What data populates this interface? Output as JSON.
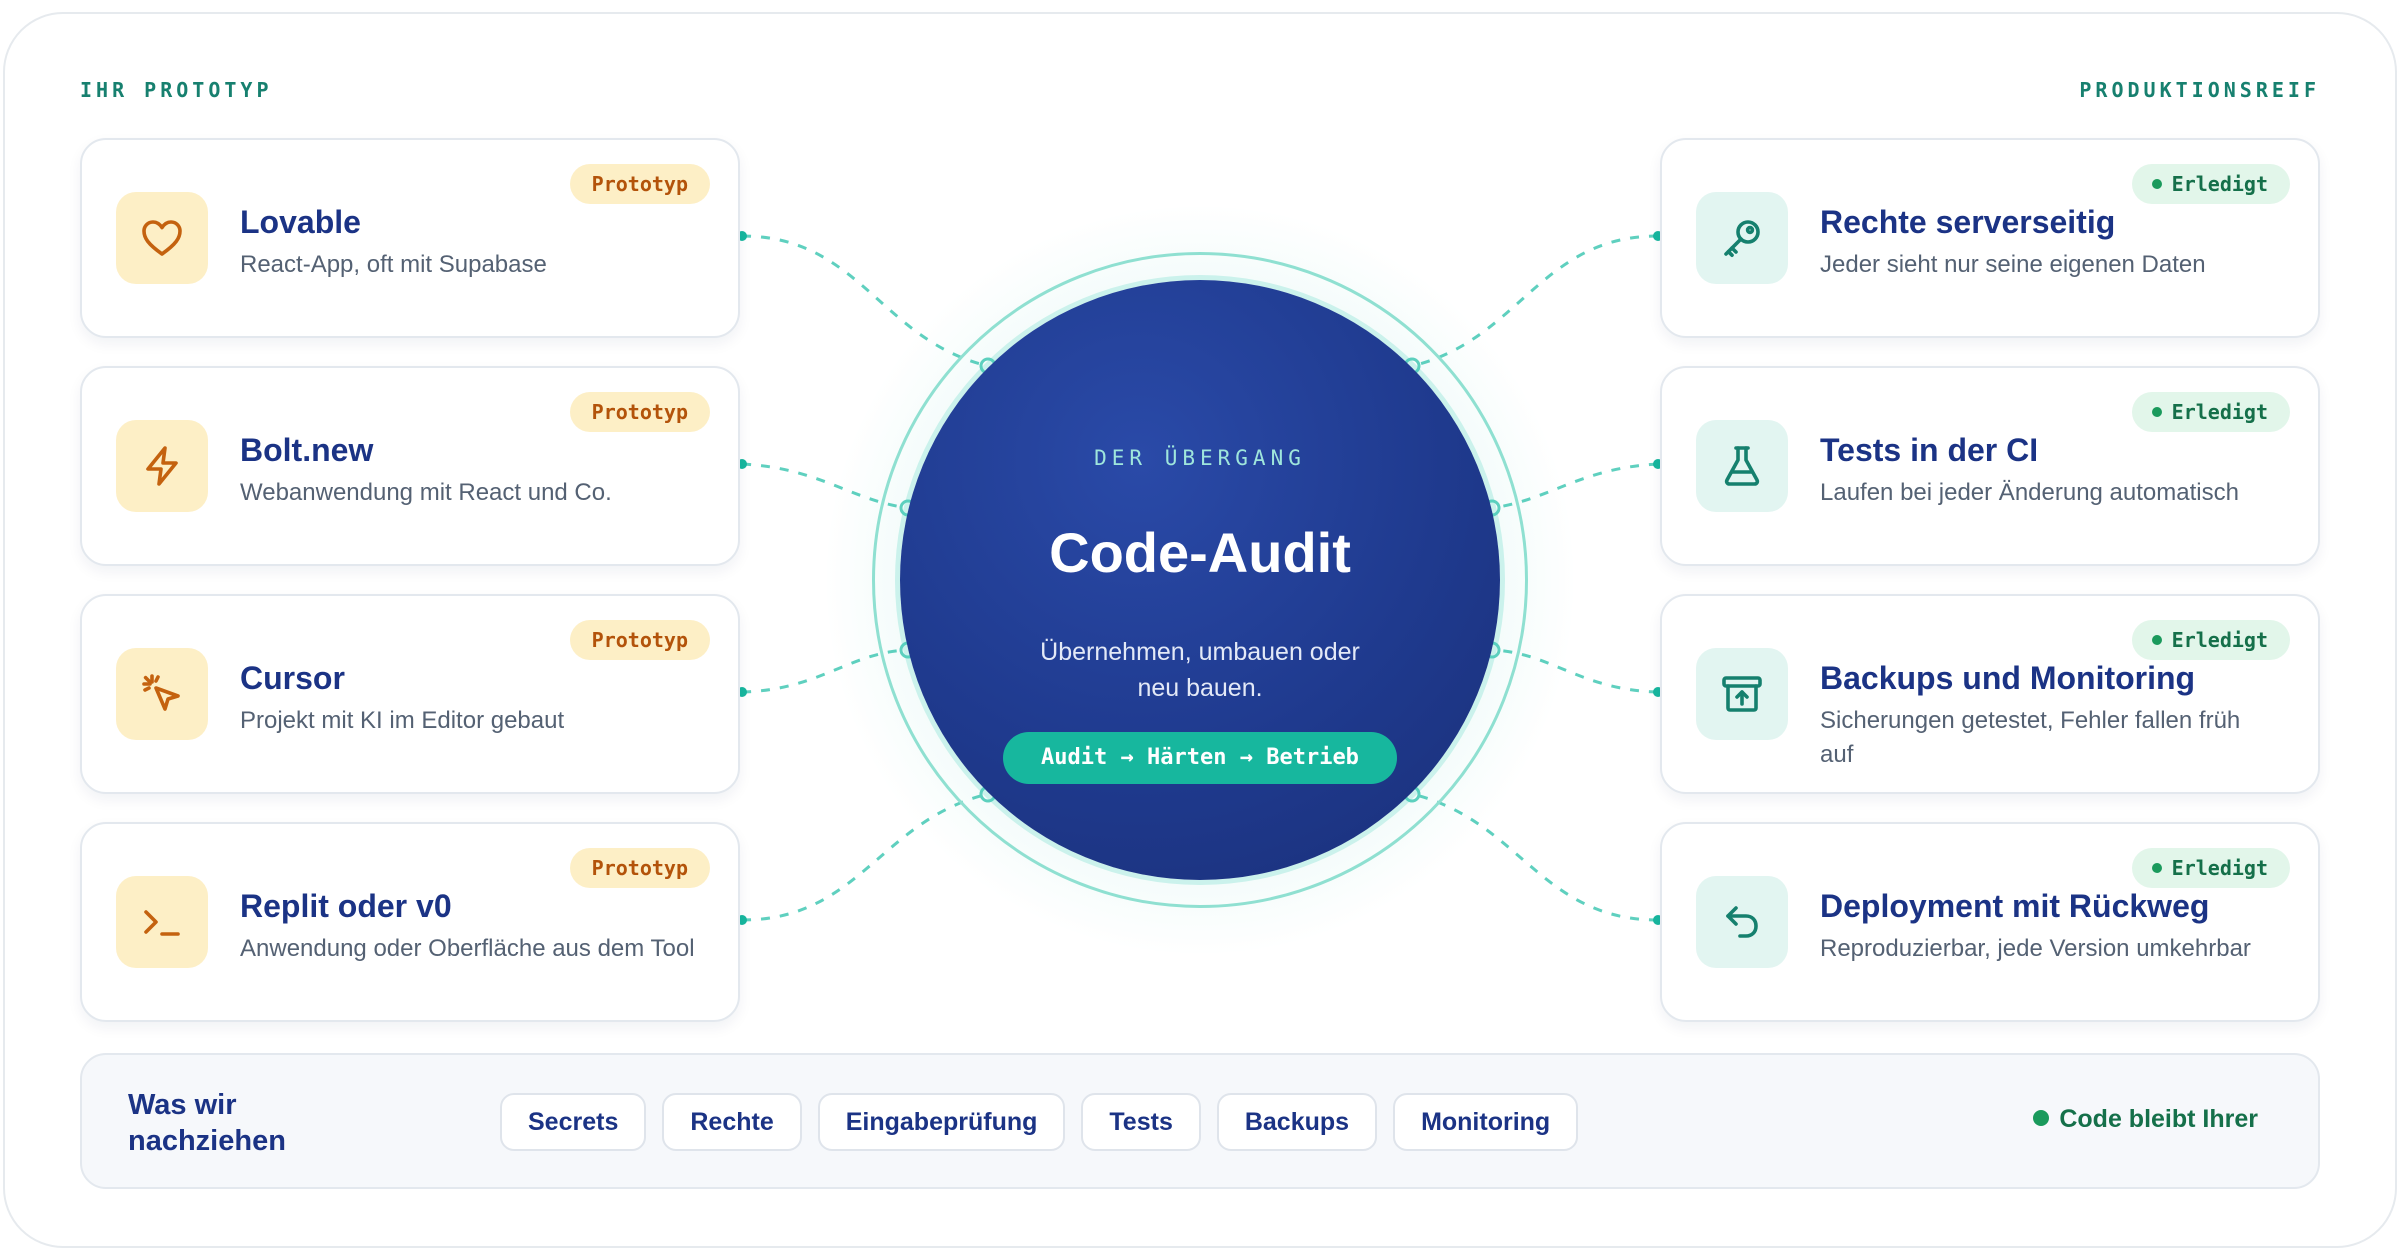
{
  "labels": {
    "left": "IHR PROTOTYP",
    "right": "PRODUKTIONSREIF"
  },
  "hub": {
    "eyebrow": "DER ÜBERGANG",
    "title": "Code-Audit",
    "text": "Übernehmen, umbauen oder neu bauen.",
    "pill": "Audit → Härten → Betrieb"
  },
  "left_cards": [
    {
      "title": "Lovable",
      "desc": "React-App, oft mit Supabase",
      "badge": "Prototyp",
      "icon": "heart-icon"
    },
    {
      "title": "Bolt.new",
      "desc": "Webanwendung mit React und Co.",
      "badge": "Prototyp",
      "icon": "lightning-icon"
    },
    {
      "title": "Cursor",
      "desc": "Projekt mit KI im Editor gebaut",
      "badge": "Prototyp",
      "icon": "cursor-click-icon"
    },
    {
      "title": "Replit oder v0",
      "desc": "Anwendung oder Oberfläche aus dem Tool",
      "badge": "Prototyp",
      "icon": "terminal-icon"
    }
  ],
  "right_cards": [
    {
      "title": "Rechte serverseitig",
      "desc": "Jeder sieht nur seine eigenen Daten",
      "badge": "Erledigt",
      "icon": "key-icon"
    },
    {
      "title": "Tests in der CI",
      "desc": "Laufen bei jeder Änderung automatisch",
      "badge": "Erledigt",
      "icon": "flask-icon"
    },
    {
      "title": "Backups und Monitoring",
      "desc": "Sicherungen getestet, Fehler fallen früh auf",
      "badge": "Erledigt",
      "icon": "archive-upload-icon"
    },
    {
      "title": "Deployment mit Rückweg",
      "desc": "Reproduzierbar, jede Version umkehrbar",
      "badge": "Erledigt",
      "icon": "undo-arrow-icon"
    }
  ],
  "bottom": {
    "title": "Was wir nachziehen",
    "chips": [
      "Secrets",
      "Rechte",
      "Eingabeprüfung",
      "Tests",
      "Backups",
      "Monitoring"
    ],
    "owner": "Code bleibt Ihrer"
  },
  "colors": {
    "navy": "#1b3385",
    "teal": "#17b79e",
    "prototype_bg": "#fdefc6",
    "prototype_text": "#b3530a",
    "done_bg": "#e2f6ea",
    "done_text": "#15704a"
  }
}
